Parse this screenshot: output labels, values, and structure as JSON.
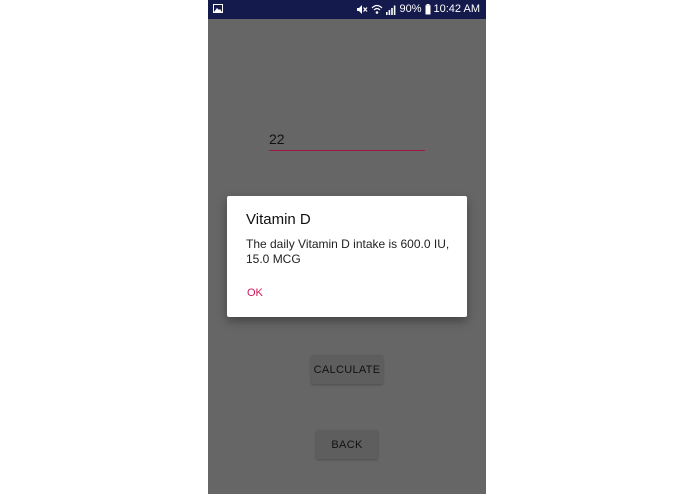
{
  "status_bar": {
    "battery": "90%",
    "time": "10:42 AM",
    "icons": [
      "gallery-icon",
      "mute-icon",
      "wifi-icon",
      "signal-icon",
      "battery-icon"
    ]
  },
  "form": {
    "age_value": "22"
  },
  "buttons": {
    "calculate": "CALCULATE",
    "back": "BACK"
  },
  "dialog": {
    "title": "Vitamin D",
    "message": "The daily Vitamin D intake is 600.0 IU, 15.0 MCG",
    "ok": "OK"
  },
  "colors": {
    "status_bar": "#141a4c",
    "scrim_background": "#666666",
    "accent": "#d3155b",
    "input_underline": "#a0154a",
    "dialog_background": "#ffffff"
  }
}
